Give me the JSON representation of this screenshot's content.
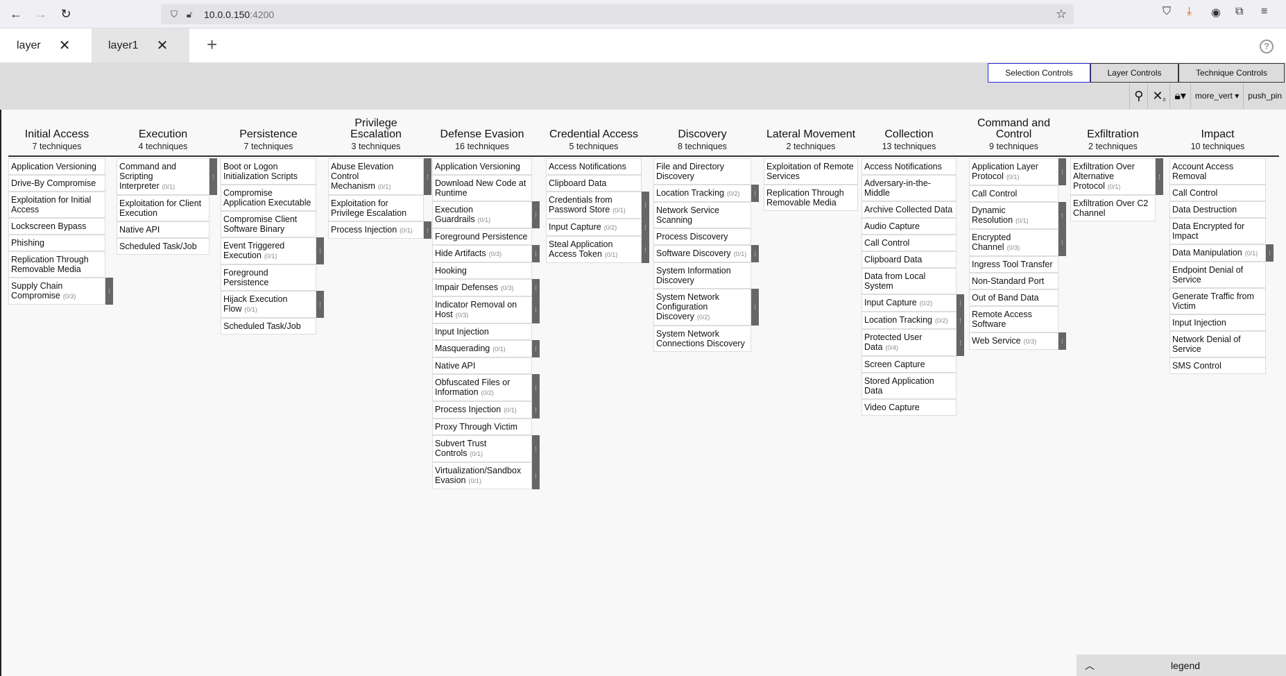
{
  "browser": {
    "url_host": "10.0.0.150",
    "url_port": ":4200"
  },
  "tabs": [
    {
      "label": "layer",
      "close": "✕"
    },
    {
      "label": "layer1",
      "close": "✕"
    }
  ],
  "new_tab": "+",
  "help": "?",
  "controls": {
    "selection": "Selection Controls",
    "layer": "Layer Controls",
    "technique": "Technique Controls"
  },
  "toolbar": {
    "more": "more_vert ▾",
    "pin": "push_pin",
    "deselect_count": "0"
  },
  "tactics": [
    {
      "name": "Initial Access",
      "count": "7 techniques",
      "techniques": [
        {
          "name": "Application Versioning"
        },
        {
          "name": "Drive-By Compromise"
        },
        {
          "name": "Exploitation for Initial Access"
        },
        {
          "name": "Lockscreen Bypass"
        },
        {
          "name": "Phishing"
        },
        {
          "name": "Replication Through Removable Media"
        },
        {
          "name": "Supply Chain Compromise",
          "sub": "(0/3)"
        }
      ]
    },
    {
      "name": "Execution",
      "count": "4 techniques",
      "techniques": [
        {
          "name": "Command and Scripting Interpreter",
          "sub": "(0/1)"
        },
        {
          "name": "Exploitation for Client Execution"
        },
        {
          "name": "Native API"
        },
        {
          "name": "Scheduled Task/Job"
        }
      ]
    },
    {
      "name": "Persistence",
      "count": "7 techniques",
      "techniques": [
        {
          "name": "Boot or Logon Initialization Scripts"
        },
        {
          "name": "Compromise Application Executable"
        },
        {
          "name": "Compromise Client Software Binary"
        },
        {
          "name": "Event Triggered Execution",
          "sub": "(0/1)"
        },
        {
          "name": "Foreground Persistence"
        },
        {
          "name": "Hijack Execution Flow",
          "sub": "(0/1)"
        },
        {
          "name": "Scheduled Task/Job"
        }
      ]
    },
    {
      "name": "Privilege Escalation",
      "count": "3 techniques",
      "techniques": [
        {
          "name": "Abuse Elevation Control Mechanism",
          "sub": "(0/1)"
        },
        {
          "name": "Exploitation for Privilege Escalation"
        },
        {
          "name": "Process Injection",
          "sub": "(0/1)"
        }
      ]
    },
    {
      "name": "Defense Evasion",
      "count": "16 techniques",
      "techniques": [
        {
          "name": "Application Versioning"
        },
        {
          "name": "Download New Code at Runtime"
        },
        {
          "name": "Execution Guardrails",
          "sub": "(0/1)"
        },
        {
          "name": "Foreground Persistence"
        },
        {
          "name": "Hide Artifacts",
          "sub": "(0/3)"
        },
        {
          "name": "Hooking"
        },
        {
          "name": "Impair Defenses",
          "sub": "(0/3)"
        },
        {
          "name": "Indicator Removal on Host",
          "sub": "(0/3)"
        },
        {
          "name": "Input Injection"
        },
        {
          "name": "Masquerading",
          "sub": "(0/1)"
        },
        {
          "name": "Native API"
        },
        {
          "name": "Obfuscated Files or Information",
          "sub": "(0/2)"
        },
        {
          "name": "Process Injection",
          "sub": "(0/1)"
        },
        {
          "name": "Proxy Through Victim"
        },
        {
          "name": "Subvert Trust Controls",
          "sub": "(0/1)"
        },
        {
          "name": "Virtualization/Sandbox Evasion",
          "sub": "(0/1)"
        }
      ]
    },
    {
      "name": "Credential Access",
      "count": "5 techniques",
      "techniques": [
        {
          "name": "Access Notifications"
        },
        {
          "name": "Clipboard Data"
        },
        {
          "name": "Credentials from Password Store",
          "sub": "(0/1)"
        },
        {
          "name": "Input Capture",
          "sub": "(0/2)"
        },
        {
          "name": "Steal Application Access Token",
          "sub": "(0/1)"
        }
      ]
    },
    {
      "name": "Discovery",
      "count": "8 techniques",
      "techniques": [
        {
          "name": "File and Directory Discovery"
        },
        {
          "name": "Location Tracking",
          "sub": "(0/2)"
        },
        {
          "name": "Network Service Scanning"
        },
        {
          "name": "Process Discovery"
        },
        {
          "name": "Software Discovery",
          "sub": "(0/1)"
        },
        {
          "name": "System Information Discovery"
        },
        {
          "name": "System Network Configuration Discovery",
          "sub": "(0/2)"
        },
        {
          "name": "System Network Connections Discovery"
        }
      ]
    },
    {
      "name": "Lateral Movement",
      "count": "2 techniques",
      "techniques": [
        {
          "name": "Exploitation of Remote Services"
        },
        {
          "name": "Replication Through Removable Media"
        }
      ]
    },
    {
      "name": "Collection",
      "count": "13 techniques",
      "techniques": [
        {
          "name": "Access Notifications"
        },
        {
          "name": "Adversary-in-the-Middle"
        },
        {
          "name": "Archive Collected Data"
        },
        {
          "name": "Audio Capture"
        },
        {
          "name": "Call Control"
        },
        {
          "name": "Clipboard Data"
        },
        {
          "name": "Data from Local System"
        },
        {
          "name": "Input Capture",
          "sub": "(0/2)"
        },
        {
          "name": "Location Tracking",
          "sub": "(0/2)"
        },
        {
          "name": "Protected User Data",
          "sub": "(0/4)"
        },
        {
          "name": "Screen Capture"
        },
        {
          "name": "Stored Application Data"
        },
        {
          "name": "Video Capture"
        }
      ]
    },
    {
      "name": "Command and Control",
      "count": "9 techniques",
      "techniques": [
        {
          "name": "Application Layer Protocol",
          "sub": "(0/1)"
        },
        {
          "name": "Call Control"
        },
        {
          "name": "Dynamic Resolution",
          "sub": "(0/1)"
        },
        {
          "name": "Encrypted Channel",
          "sub": "(0/3)"
        },
        {
          "name": "Ingress Tool Transfer"
        },
        {
          "name": "Non-Standard Port"
        },
        {
          "name": "Out of Band Data"
        },
        {
          "name": "Remote Access Software"
        },
        {
          "name": "Web Service",
          "sub": "(0/3)"
        }
      ]
    },
    {
      "name": "Exfiltration",
      "count": "2 techniques",
      "techniques": [
        {
          "name": "Exfiltration Over Alternative Protocol",
          "sub": "(0/1)"
        },
        {
          "name": "Exfiltration Over C2 Channel"
        }
      ]
    },
    {
      "name": "Impact",
      "count": "10 techniques",
      "techniques": [
        {
          "name": "Account Access Removal"
        },
        {
          "name": "Call Control"
        },
        {
          "name": "Data Destruction"
        },
        {
          "name": "Data Encrypted for Impact"
        },
        {
          "name": "Data Manipulation",
          "sub": "(0/1)"
        },
        {
          "name": "Endpoint Denial of Service"
        },
        {
          "name": "Generate Traffic from Victim"
        },
        {
          "name": "Input Injection"
        },
        {
          "name": "Network Denial of Service"
        },
        {
          "name": "SMS Control"
        }
      ]
    }
  ],
  "legend": {
    "label": "legend",
    "chevron": "︿"
  }
}
